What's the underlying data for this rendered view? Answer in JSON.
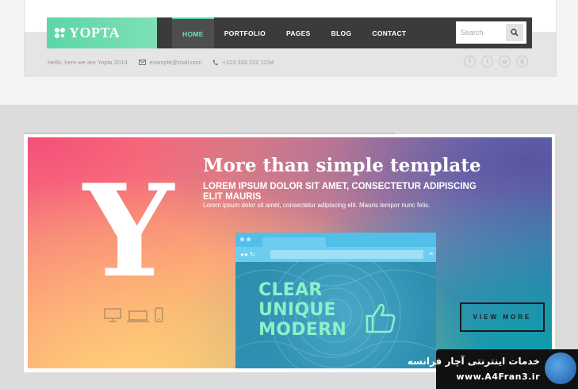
{
  "logo": {
    "text": "YOPTA"
  },
  "nav": {
    "items": [
      {
        "label": "HOME"
      },
      {
        "label": "PORTFOLIO"
      },
      {
        "label": "PAGES"
      },
      {
        "label": "BLOG"
      },
      {
        "label": "CONTACT"
      }
    ]
  },
  "search": {
    "placeholder": "Search",
    "icon": "search-icon"
  },
  "info": {
    "welcome": "Hello, here we are Yopta 2014",
    "email": "example@mail.com",
    "phone": "+123 333 222 1234"
  },
  "socials": [
    {
      "icon": "facebook-icon",
      "glyph": "f"
    },
    {
      "icon": "twitter-icon",
      "glyph": "t"
    },
    {
      "icon": "dribbble-icon",
      "glyph": "◎"
    },
    {
      "icon": "google-plus-icon",
      "glyph": "g"
    }
  ],
  "banner": {
    "letter": "Y",
    "title": "More than simple template",
    "subtitle": "LOREM IPSUM DOLOR SIT AMET, CONSECTETUR ADIPISCING ELIT MAURIS",
    "description": "Lorem ipsum dolor sit amet, consectetur adipiscing elit. Mauris tempor nunc felis.",
    "browser_lines": [
      "CLEAR",
      "UNIQUE",
      "MODERN"
    ],
    "cta": "VIEW MORE"
  },
  "watermark": {
    "line1": "خدمات اینترنتی آچار فرانسه",
    "line2": "www.A4Fran3.ir"
  },
  "colors": {
    "accent": "#5cd6a6",
    "nav_bg": "#3b3b3b",
    "browser_text": "#8ef0c8"
  }
}
